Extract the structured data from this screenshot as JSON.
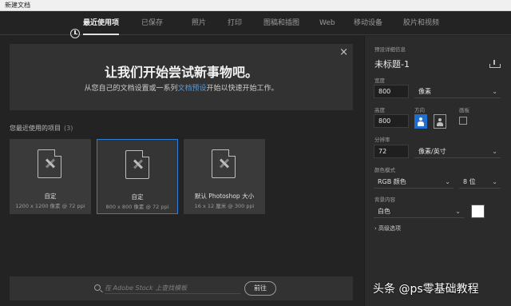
{
  "window": {
    "title": "新建文档"
  },
  "tabs": [
    {
      "label": "最近使用项",
      "active": true
    },
    {
      "label": "已保存"
    },
    {
      "label": "照片"
    },
    {
      "label": "打印"
    },
    {
      "label": "图稿和插图"
    },
    {
      "label": "Web"
    },
    {
      "label": "移动设备"
    },
    {
      "label": "胶片和视频"
    }
  ],
  "welcome": {
    "heading": "让我们开始尝试新事物吧。",
    "text_before": "从您自己的文档设置或一系列",
    "link": "文档预设",
    "text_after": "开始以快速开始工作。",
    "close": "×"
  },
  "recent": {
    "title": "您最近使用的项目",
    "count": "(3)",
    "items": [
      {
        "name": "自定",
        "meta": "1200 x 1200 像素 @ 72 ppi",
        "selected": false
      },
      {
        "name": "自定",
        "meta": "800 x 800 像素 @ 72 ppi",
        "selected": true
      },
      {
        "name": "默认 Photoshop 大小",
        "meta": "16 x 12 厘米 @ 300 ppi",
        "selected": false
      }
    ]
  },
  "search": {
    "placeholder": "在 Adobe Stock 上查找模板",
    "button": "前往"
  },
  "details": {
    "section_title": "预设详细信息",
    "doc_title": "未标题-1",
    "width_label": "宽度",
    "width_value": "800",
    "width_unit": "像素",
    "height_label": "高度",
    "height_value": "800",
    "orientation_label": "方向",
    "artboard_label": "画板",
    "resolution_label": "分辨率",
    "resolution_value": "72",
    "resolution_unit": "像素/英寸",
    "color_mode_label": "颜色模式",
    "color_mode": "RGB 颜色",
    "bit_depth": "8 位",
    "background_label": "背景内容",
    "background": "白色",
    "background_color": "#ffffff",
    "advanced": "高级选项"
  },
  "watermark": "头条 @ps零基础教程"
}
